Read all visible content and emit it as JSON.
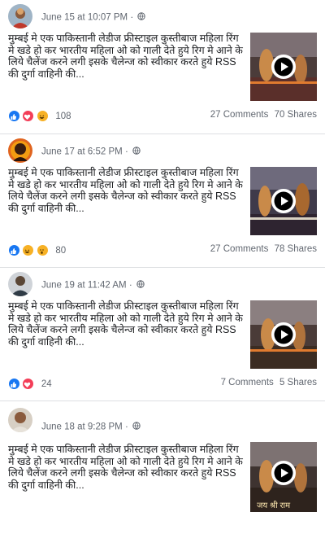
{
  "posts": [
    {
      "timestamp": "June 15 at 10:07 PM",
      "separator": "·",
      "text": "मुम्बई मे एक पाकिस्तानी लेडीज फ्रीस्टाइल कुस्तीबाज महिला रिंग मे खडे हो कर भारतीय महिला ओ को गाली देते हुये रिग मे आने के लिये चैलेंज करने लगी इसके चैलेन्ज को स्वीकार करते हुये RSS की दुर्गा वाहिनी की...",
      "reaction_count": "108",
      "reactions": [
        "like",
        "love",
        "haha"
      ],
      "comments": "27 Comments",
      "shares": "70 Shares",
      "video_caption": ""
    },
    {
      "timestamp": "June 17 at 6:52 PM",
      "separator": "·",
      "text": "मुम्बई मे एक पाकिस्तानी लेडीज फ्रीस्टाइल कुस्तीबाज महिला रिंग मे खडे हो कर भारतीय महिला ओ को गाली देते हुये रिग मे आने के लिये चैलेंज करने लगी इसके चैलेन्ज को स्वीकार करते हुये RSS की दुर्गा वाहिनी की...",
      "reaction_count": "80",
      "reactions": [
        "like",
        "haha",
        "wow"
      ],
      "comments": "27 Comments",
      "shares": "78 Shares",
      "video_caption": ""
    },
    {
      "timestamp": "June 19 at 11:42 AM",
      "separator": "·",
      "text": "मुम्बई मे एक पाकिस्तानी लेडीज फ्रीस्टाइल कुस्तीबाज महिला रिंग मे खडे हो कर भारतीय महिला ओ को गाली देते हुये रिग मे आने के लिये चैलेंज करने लगी इसके चैलेन्ज को स्वीकार करते हुये RSS की दुर्गा वाहिनी की...",
      "reaction_count": "24",
      "reactions": [
        "like",
        "love"
      ],
      "comments": "7 Comments",
      "shares": "5 Shares",
      "video_caption": ""
    },
    {
      "timestamp": "June 18 at 9:28 PM",
      "separator": "·",
      "text": "मुम्बई मे एक पाकिस्तानी लेडीज फ्रीस्टाइल कुस्तीबाज महिला रिंग मे खडे हो कर भारतीय महिला ओ को गाली देते हुये रिग मे आने के लिये चैलेंज करने लगी इसके चैलेन्ज को स्वीकार करते हुये RSS की दुर्गा वाहिनी की...",
      "reaction_count": "",
      "reactions": [],
      "comments": "",
      "shares": "",
      "video_caption": "जय श्री राम"
    }
  ],
  "colors": {
    "like": "#1877f2",
    "love": "#f33e58",
    "haha": "#f7b125",
    "wow": "#f7b125",
    "meta_text": "#616770",
    "divider": "#dddfe2"
  }
}
